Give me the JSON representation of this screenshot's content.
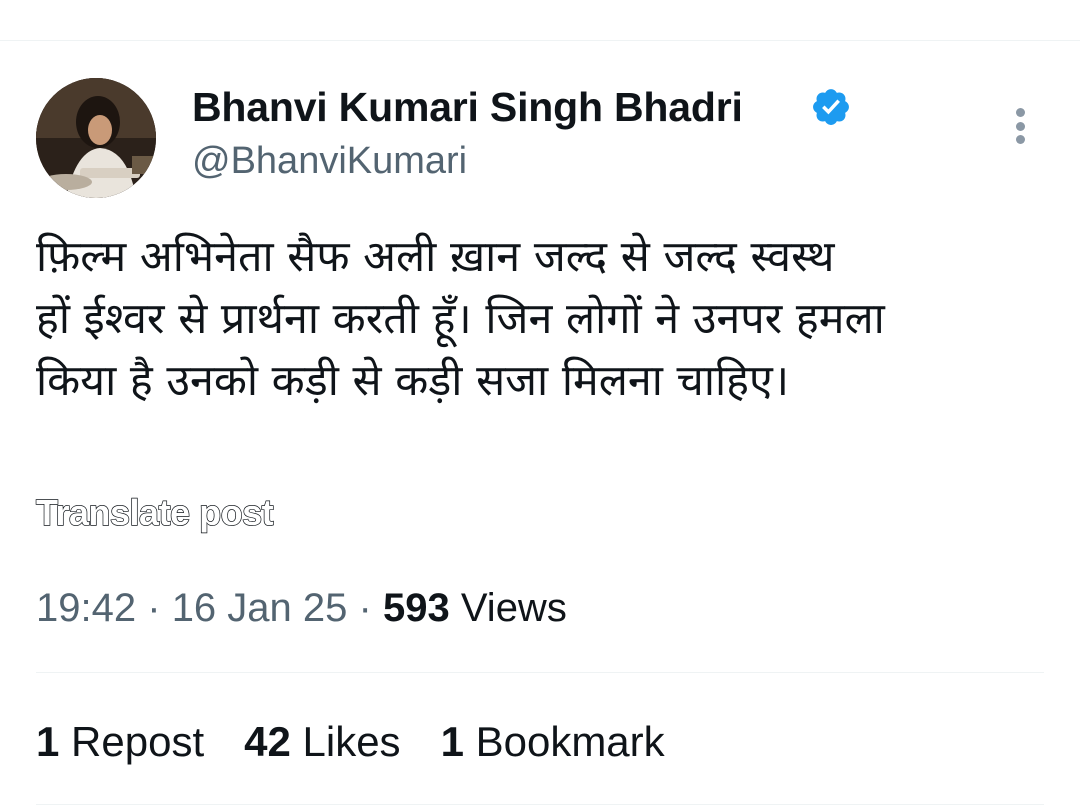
{
  "author": {
    "display_name": "Bhanvi Kumari Singh Bhadri",
    "handle": "@BhanviKumari",
    "verified_badge_color": "#1d9bf0",
    "avatar_icon": "profile-photo"
  },
  "post": {
    "text_lines": [
      "फ़िल्म अभिनेता सैफ अली ख़ान जल्द से जल्द स्वस्थ",
      "हों ईश्वर से प्रार्थना करती हूँ। जिन लोगों ने उनपर हमला",
      "किया है उनको कड़ी से कड़ी सजा मिलना चाहिए।"
    ],
    "translate_label": "Translate post",
    "time": "19:42",
    "date": "16 Jan 25",
    "views_count": "593",
    "views_label": "Views",
    "separator": "·"
  },
  "stats": {
    "reposts_count": "1",
    "reposts_label": "Repost",
    "likes_count": "42",
    "likes_label": "Likes",
    "bookmarks_count": "1",
    "bookmarks_label": "Bookmark"
  },
  "more_icon": "ellipsis-vertical-icon"
}
